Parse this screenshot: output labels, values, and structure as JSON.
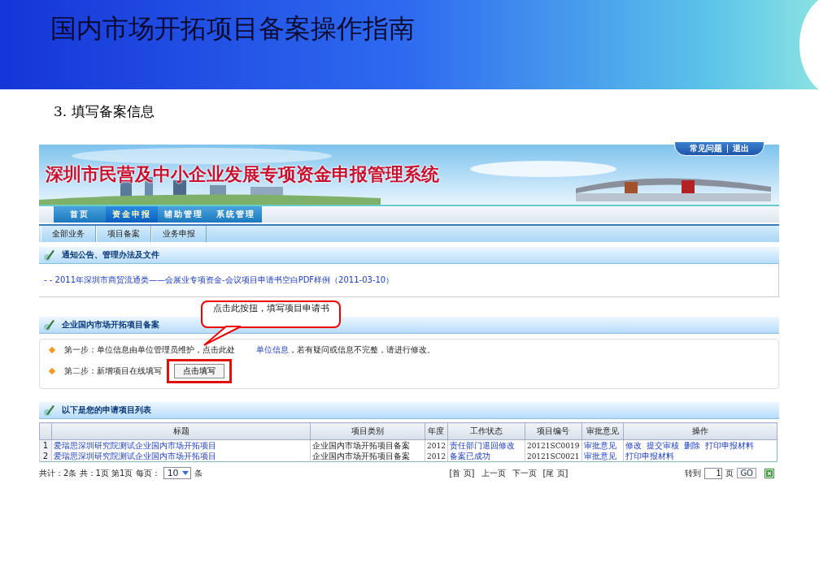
{
  "slide": {
    "title": "国内市场开拓项目备案操作指南",
    "step": "3.  填写备案信息"
  },
  "site": {
    "title": "深圳市民营及中小企业发展专项资金申报管理系统",
    "top_links": [
      "常见问题",
      "退出"
    ]
  },
  "nav_tabs": [
    {
      "label": "首页",
      "selected": false
    },
    {
      "label": "资金申报",
      "selected": true
    },
    {
      "label": "辅助管理",
      "selected": false
    },
    {
      "label": "系统管理",
      "selected": false
    }
  ],
  "sub_tabs": [
    "全部业务",
    "项目备案",
    "业务申报"
  ],
  "notices": {
    "heading": "通知公告、管理办法及文件",
    "items": [
      "- - 2011年深圳市商贸流通类——会展业专项资金-会议项目申请书空白PDF样例（2011-03-10）"
    ]
  },
  "filing": {
    "heading": "企业国内市场开拓项目备案",
    "step1": {
      "before": "第一步：单位信息由单位管理员维护，点击此处",
      "link": "单位信息",
      "after": "，若有疑问或信息不完整，请进行修改。"
    },
    "step2": {
      "label": "第二步：新增项目在线填写",
      "button": "点击填写"
    }
  },
  "callout": {
    "text": "点击此按扭，填写项目申请书"
  },
  "projects": {
    "heading": "以下是您的申请项目列表",
    "columns": [
      "标题",
      "项目类别",
      "年度",
      "工作状态",
      "项目编号",
      "审批意见",
      "操作"
    ],
    "rows": [
      {
        "index": "1",
        "title": "爱瑞思深圳研究院测试企业国内市场开拓项目",
        "category": "企业国内市场开拓项目备案",
        "year": "2012",
        "status": "责任部门退回修改",
        "number": "20121SC0019",
        "opinion": "审批意见",
        "actions": [
          "修改",
          "提交审核",
          "删除",
          "打印申报材料"
        ]
      },
      {
        "index": "2",
        "title": "爱瑞思深圳研究院测试企业国内市场开拓项目",
        "category": "企业国内市场开拓项目备案",
        "year": "2012",
        "status": "备案已成功",
        "number": "20121SC0021",
        "opinion": "审批意见",
        "actions": [
          "打印申报材料"
        ]
      }
    ]
  },
  "pager": {
    "summary": "共计：2条 共：1页 第1页 每页：",
    "page_size": "10",
    "unit": "条",
    "links": [
      "[首 页]",
      "上一页",
      "下一页",
      "[尾 页]"
    ],
    "goto_label": "转到",
    "goto_value": "1",
    "page_unit": "页",
    "go": "GO"
  }
}
